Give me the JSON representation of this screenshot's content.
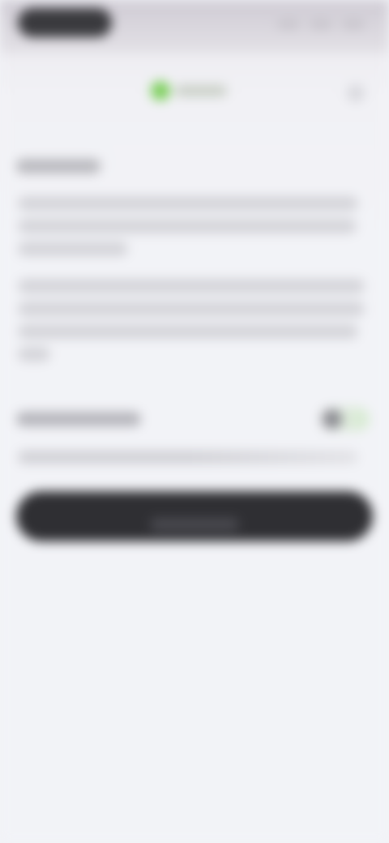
{
  "status_bar": {
    "time": "",
    "icons": [
      "signal-icon",
      "wifi-icon",
      "battery-icon"
    ]
  },
  "header": {
    "brand_name": "",
    "close_icon": "close-icon",
    "brand_color": "#7bcf5a"
  },
  "content": {
    "section_title": "",
    "paragraph_1": [
      "",
      "",
      ""
    ],
    "paragraph_2": [
      "",
      "",
      "",
      ""
    ]
  },
  "setting": {
    "label": "",
    "toggle_state": "on",
    "hint": ""
  },
  "primary_button": {
    "label": ""
  },
  "colors": {
    "accent": "#7bcf5a",
    "button": "#2f2f33",
    "background": "#f2f3f7"
  }
}
